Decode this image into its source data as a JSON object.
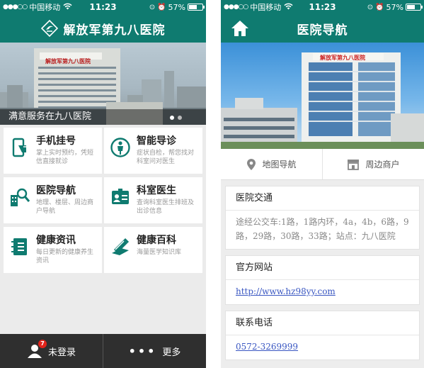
{
  "status_left": {
    "carrier": "中国移动",
    "time": "11:23",
    "battery": "57%"
  },
  "status_right": {
    "carrier": "中国移动",
    "time": "11:23",
    "battery": "57%"
  },
  "home": {
    "title": "解放军第九八医院",
    "banner_caption": "满意服务在九八医院",
    "banner_sign": "解放军第九八医院",
    "tiles": [
      {
        "title": "手机挂号",
        "desc": "掌上实时预约，凭短信直接就诊",
        "icon": "phone-register-icon"
      },
      {
        "title": "智能导诊",
        "desc": "症状自检，帮您找对科室问对医生",
        "icon": "guide-person-icon"
      },
      {
        "title": "医院导航",
        "desc": "地理、楼层、周边商户导航",
        "icon": "building-search-icon"
      },
      {
        "title": "科室医生",
        "desc": "查询科室医生排班及出诊信息",
        "icon": "doctor-card-icon"
      },
      {
        "title": "健康资讯",
        "desc": "每日更新的健康养生资讯",
        "icon": "notebook-icon"
      },
      {
        "title": "健康百科",
        "desc": "海量医学知识库",
        "icon": "pencil-book-icon"
      }
    ],
    "bottom": {
      "login_label": "未登录",
      "badge": "7",
      "more_label": "更多",
      "more_dots": "•••"
    }
  },
  "nav": {
    "title": "医院导航",
    "banner_sign": "解放军第九八医院",
    "actions": [
      {
        "label": "地图导航",
        "icon": "map-pin-icon"
      },
      {
        "label": "周边商户",
        "icon": "shop-icon"
      }
    ],
    "sections": {
      "traffic": {
        "title": "医院交通",
        "body": "途经公交车:1路，1路内环，4a，4b，6路，9路，29路，30路，33路；站点：九八医院"
      },
      "website": {
        "title": "官方网站",
        "link": "http://www.hz98yy.com"
      },
      "phone": {
        "title": "联系电话",
        "number": "0572-3269999"
      }
    }
  },
  "colors": {
    "primary": "#0f7b70",
    "bottom_bar": "#2f2f2f",
    "link": "#3a57c2",
    "badge": "#e2231a"
  }
}
